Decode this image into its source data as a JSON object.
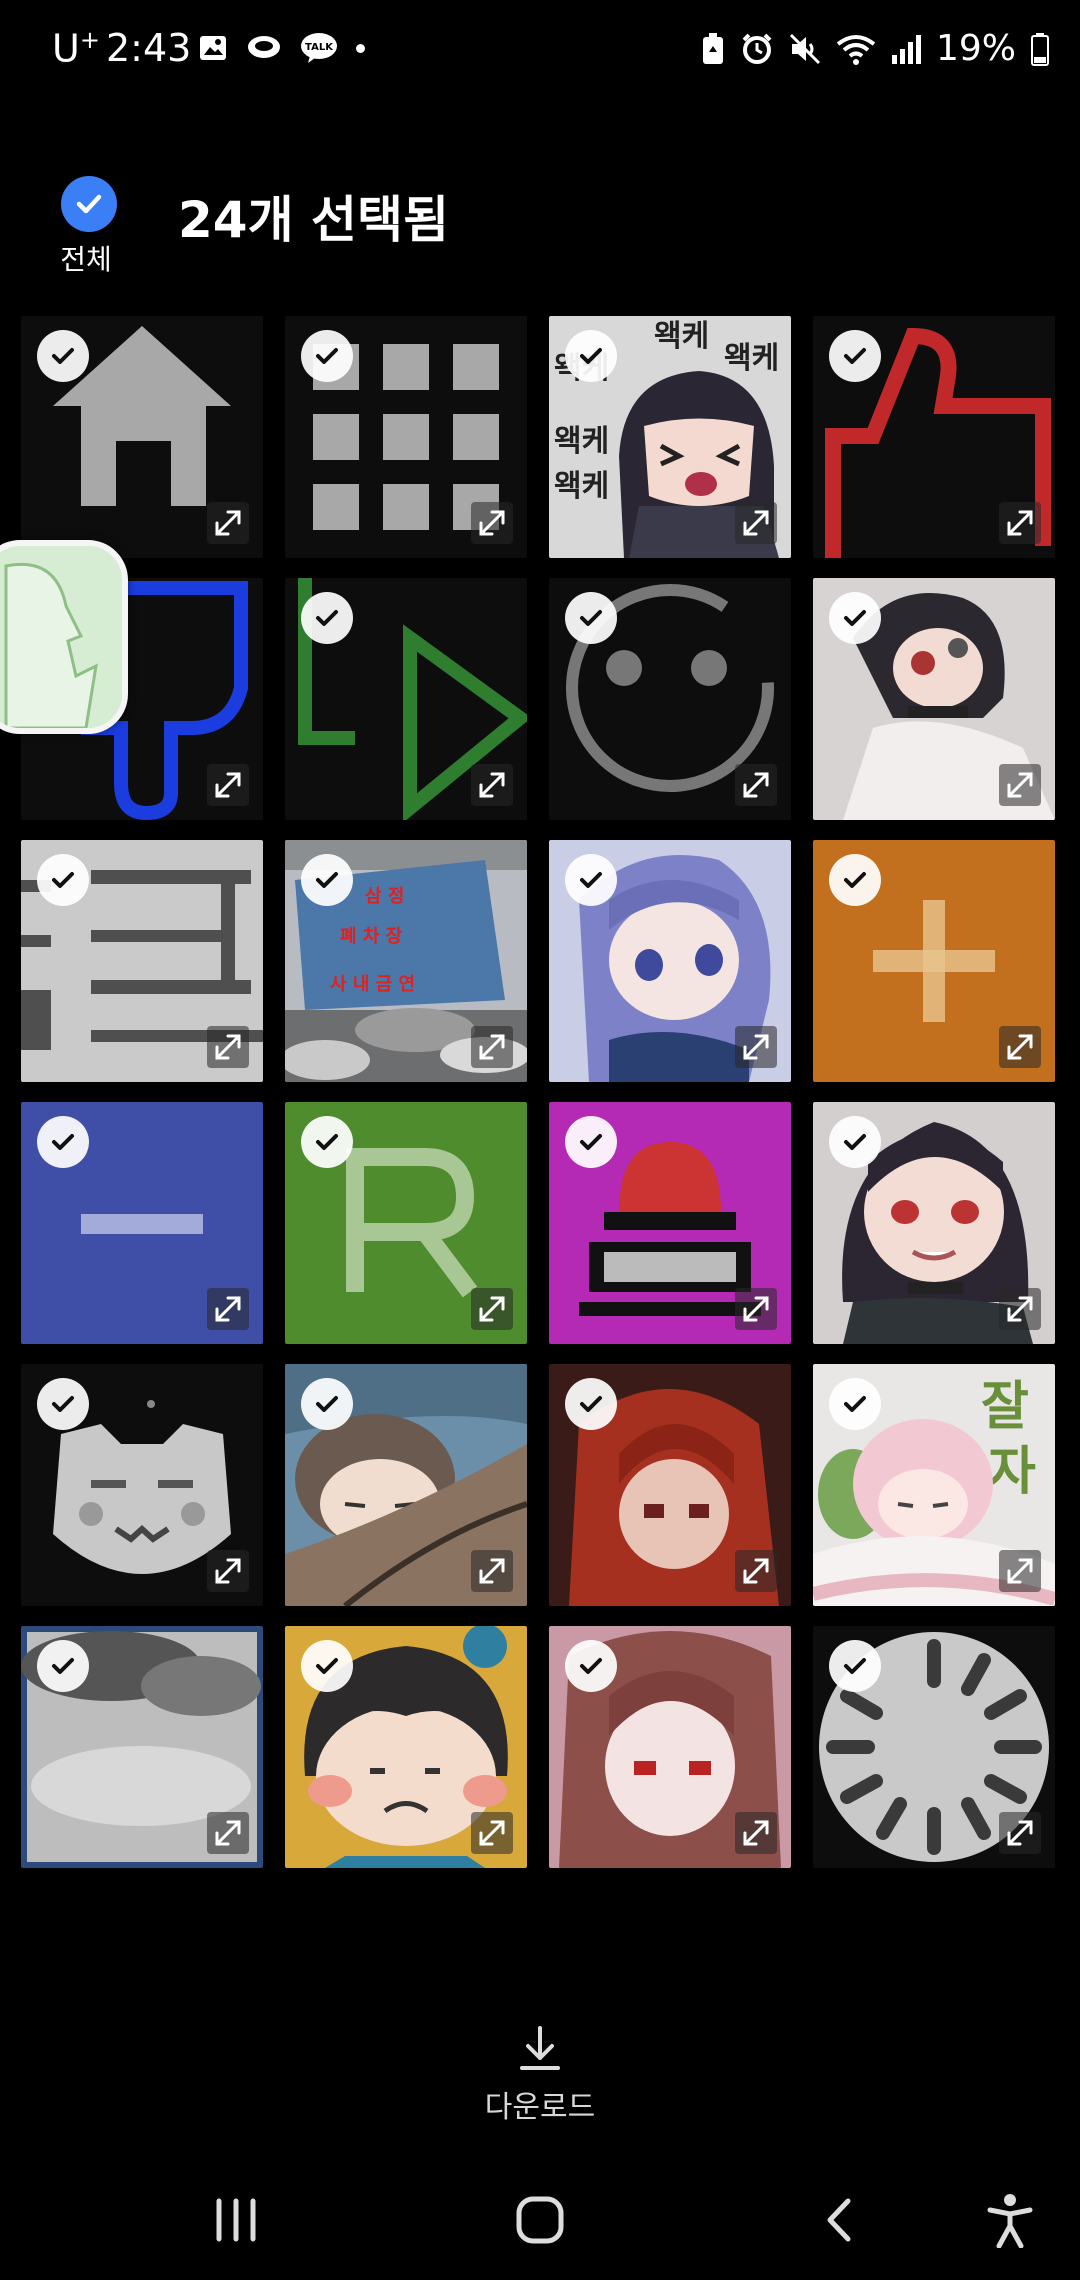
{
  "status_bar": {
    "carrier": "U",
    "carrier_suffix": "+",
    "time": "2:43",
    "battery": "19%",
    "icons_left": [
      "gallery-icon",
      "chat-bubble-icon",
      "kakaotalk-icon"
    ],
    "icons_right": [
      "battery-saver-icon",
      "alarm-icon",
      "mute-icon",
      "wifi-icon",
      "signal-icon",
      "battery-icon"
    ]
  },
  "header": {
    "select_all_label": "전체",
    "selection_count": "24개 선택됨",
    "accent_color": "#3a7ff6"
  },
  "tiles": [
    {
      "name": "home-icon-image"
    },
    {
      "name": "apps-grid-image"
    },
    {
      "name": "anime-welke-sticker"
    },
    {
      "name": "thumbs-up-red-image"
    },
    {
      "name": "thumbs-down-blue-image"
    },
    {
      "name": "green-arrow-image"
    },
    {
      "name": "smiley-face-image"
    },
    {
      "name": "anime-girl-portrait"
    },
    {
      "name": "blurred-text-image"
    },
    {
      "name": "scrapyard-building-photo"
    },
    {
      "name": "anime-girl-purple-hair"
    },
    {
      "name": "orange-plus-image"
    },
    {
      "name": "blue-minus-image"
    },
    {
      "name": "green-r-image"
    },
    {
      "name": "red-button-image"
    },
    {
      "name": "anime-girl-smile"
    },
    {
      "name": "pixel-cat-face"
    },
    {
      "name": "sleeping-chibi-image"
    },
    {
      "name": "pixel-redhead-image"
    },
    {
      "name": "sleeping-pink-girl-sticker"
    },
    {
      "name": "blurred-cloud-image"
    },
    {
      "name": "chibi-boy-image"
    },
    {
      "name": "pixel-girl-image"
    },
    {
      "name": "loading-spinner-image"
    }
  ],
  "tile_text": {
    "welke": "왝케",
    "sign_top": "삼 정",
    "sign_mid": "폐 차 장",
    "sign_bottom": "사 내 금 연",
    "sleep_text": "잘",
    "sleep_text2": "자"
  },
  "download": {
    "label": "다운로드"
  },
  "nav_bar": {
    "buttons": [
      "recent-apps",
      "home",
      "back",
      "accessibility"
    ]
  }
}
